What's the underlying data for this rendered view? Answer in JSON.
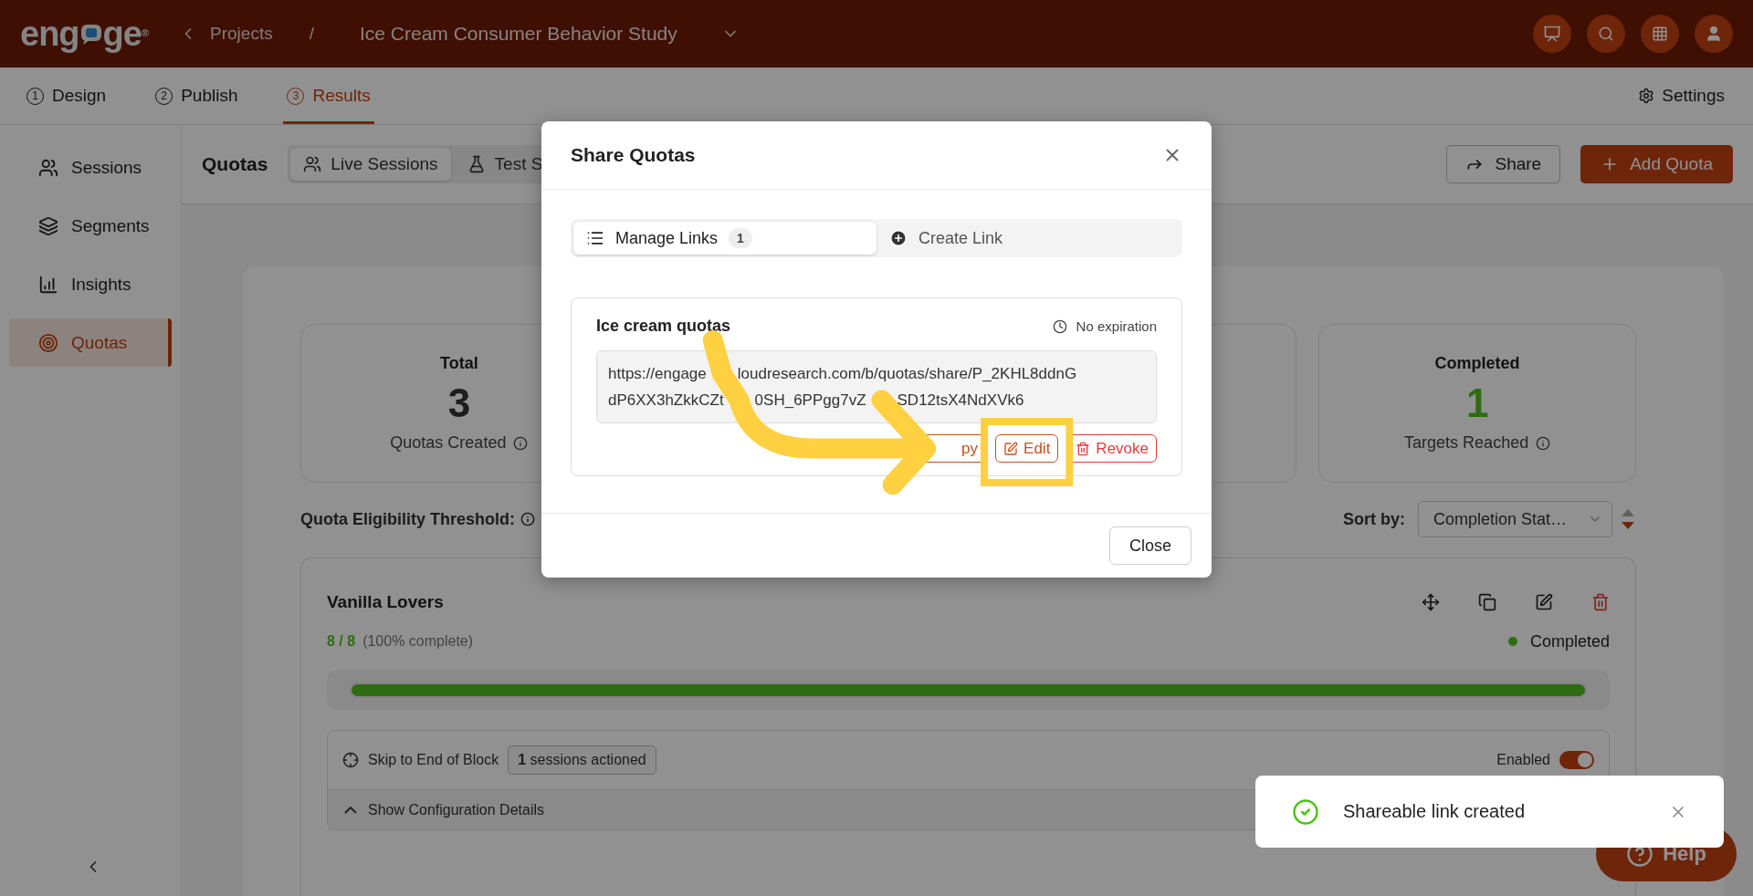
{
  "app": {
    "logo": {
      "prefix": "eng",
      "suffix": "ge",
      "mark": "®"
    },
    "breadcrumb": {
      "parent": "Projects",
      "separator": "/",
      "project": "Ice Cream Consumer Behavior Study"
    }
  },
  "steps": [
    {
      "number": "1",
      "label": "Design",
      "selected": false
    },
    {
      "number": "2",
      "label": "Publish",
      "selected": false
    },
    {
      "number": "3",
      "label": "Results",
      "selected": true
    }
  ],
  "settings": "Settings",
  "sidebar": {
    "items": [
      {
        "label": "Sessions",
        "kind": "users",
        "selected": false
      },
      {
        "label": "Segments",
        "kind": "layers",
        "selected": false
      },
      {
        "label": "Insights",
        "kind": "chart",
        "selected": false
      },
      {
        "label": "Quotas",
        "kind": "target",
        "selected": true
      }
    ]
  },
  "page": {
    "title": "Quotas",
    "source_tabs": [
      {
        "label": "Live Sessions",
        "kind": "users",
        "selected": true
      },
      {
        "label": "Test S",
        "kind": "flask",
        "selected": false
      }
    ],
    "share": "Share",
    "add": "Add Quota"
  },
  "stats": [
    {
      "title": "Total",
      "value": "3",
      "caption": "Quotas Created",
      "kind": "neutral"
    },
    {
      "title": "Completed",
      "value": "1",
      "caption": "Targets Reached",
      "kind": "success"
    }
  ],
  "threshold": "Quota Eligibility Threshold:",
  "sort": {
    "label": "Sort by:",
    "value": "Completion Stat…",
    "descending": true
  },
  "quota": {
    "name": "Vanilla Lovers",
    "count": "8 / 8",
    "percent": "(100% complete)",
    "status": "Completed",
    "level": 1,
    "action": "Skip to End of Block",
    "sessions_count": "1",
    "sessions_label": "sessions actioned",
    "enabled_label": "Enabled",
    "enabled": true,
    "details": "Show Configuration Details"
  },
  "modal": {
    "title": "Share Quotas",
    "tabs": [
      {
        "label": "Manage Links",
        "badge": "1",
        "kind": "list",
        "selected": true
      },
      {
        "label": "Create Link",
        "kind": "plus",
        "selected": false
      }
    ],
    "link": {
      "name": "Ice cream quotas",
      "expiry": "No expiration",
      "url_lines": [
        [
          "https://engage",
          "loudresearch.com/b/quotas/share/P_2KHL8ddnG"
        ],
        [
          "dP6XX3hZkkCZt",
          "0SH_6PPgg7vZ",
          "SD12tsX4NdXVk6"
        ]
      ],
      "actions": [
        {
          "label": "py",
          "kind": "copy"
        },
        {
          "label": "Edit",
          "kind": "edit"
        },
        {
          "label": "Revoke",
          "kind": "revoke"
        }
      ]
    },
    "close": "Close"
  },
  "toast": {
    "message": "Shareable link created",
    "kind": "success"
  },
  "help": "Help"
}
